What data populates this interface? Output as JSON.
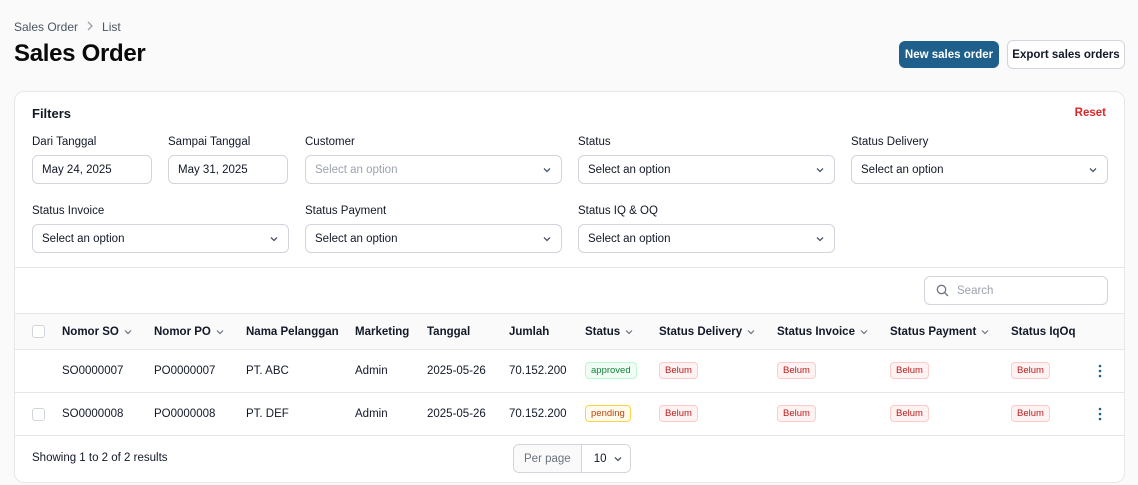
{
  "breadcrumb": {
    "items": [
      "Sales Order",
      "List"
    ]
  },
  "page": {
    "title": "Sales Order"
  },
  "header_actions": {
    "new_label": "New sales order",
    "export_label": "Export sales orders"
  },
  "filters": {
    "title": "Filters",
    "reset_label": "Reset",
    "dari_tanggal": {
      "label": "Dari Tanggal",
      "value": "May 24, 2025"
    },
    "sampai_tanggal": {
      "label": "Sampai Tanggal",
      "value": "May 31, 2025"
    },
    "customer": {
      "label": "Customer",
      "placeholder": "Select an option"
    },
    "status": {
      "label": "Status",
      "value": "Select an option"
    },
    "status_delivery": {
      "label": "Status Delivery",
      "value": "Select an option"
    },
    "status_invoice": {
      "label": "Status Invoice",
      "value": "Select an option"
    },
    "status_payment": {
      "label": "Status Payment",
      "value": "Select an option"
    },
    "status_iq_oq": {
      "label": "Status IQ & OQ",
      "value": "Select an option"
    }
  },
  "search": {
    "placeholder": "Search"
  },
  "table": {
    "columns": [
      "Nomor SO",
      "Nomor PO",
      "Nama Pelanggan",
      "Marketing",
      "Tanggal",
      "Jumlah",
      "Status",
      "Status Delivery",
      "Status Invoice",
      "Status Payment",
      "Status IqOq"
    ],
    "rows": [
      {
        "nomor_so": "SO0000007",
        "nomor_po": "PO0000007",
        "pelanggan": "PT. ABC",
        "marketing": "Admin",
        "tanggal": "2025-05-26",
        "jumlah": "70.152.200",
        "status": "approved",
        "delivery": "Belum",
        "invoice": "Belum",
        "payment": "Belum",
        "iqoq": "Belum"
      },
      {
        "nomor_so": "SO0000008",
        "nomor_po": "PO0000008",
        "pelanggan": "PT. DEF",
        "marketing": "Admin",
        "tanggal": "2025-05-26",
        "jumlah": "70.152.200",
        "status": "pending",
        "delivery": "Belum",
        "invoice": "Belum",
        "payment": "Belum",
        "iqoq": "Belum"
      }
    ]
  },
  "pagination": {
    "summary": "Showing 1 to 2 of 2 results",
    "per_page_label": "Per page",
    "per_page_value": "10"
  },
  "colors": {
    "primary": "#1e5f8c",
    "reset": "#dc2626",
    "approved": "#15803d",
    "pending": "#c2410c",
    "belum": "#b91c1c"
  }
}
